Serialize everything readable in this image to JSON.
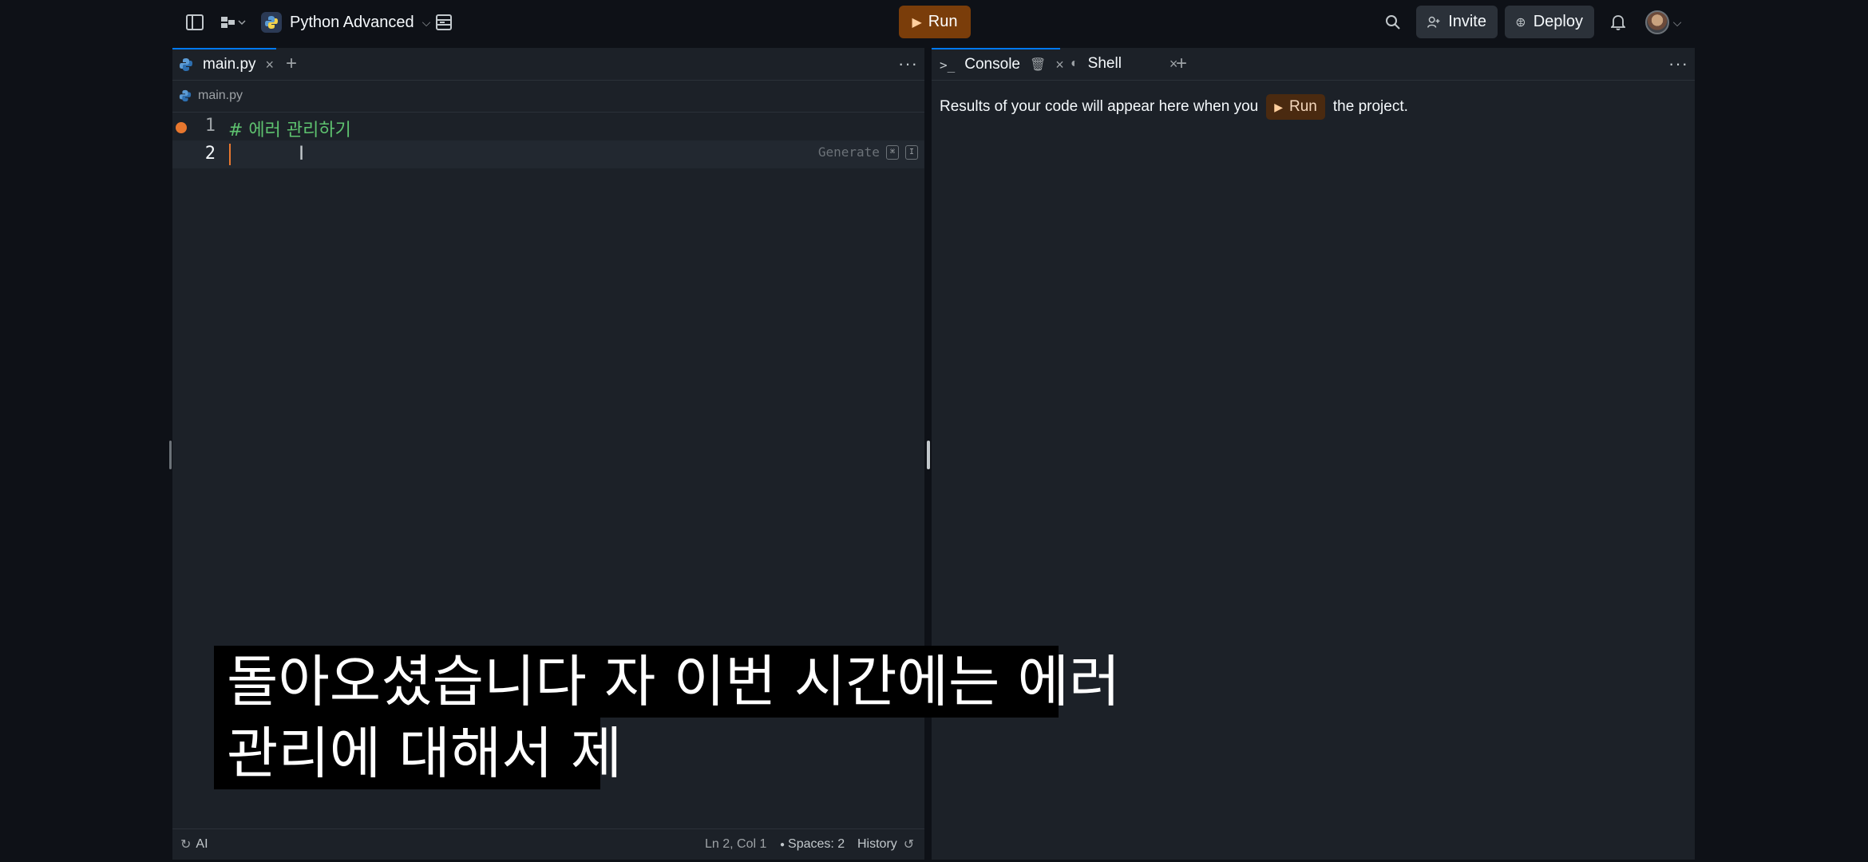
{
  "topbar": {
    "project_name": "Python Advanced",
    "run_label": "Run",
    "invite_label": "Invite",
    "deploy_label": "Deploy"
  },
  "editor": {
    "tab_label": "main.py",
    "breadcrumb": "main.py",
    "lines": [
      {
        "number": "1",
        "text": "# 에러 관리하기"
      },
      {
        "number": "2",
        "text": ""
      }
    ],
    "generate_hint": "Generate",
    "generate_kbd_1": "⌘",
    "generate_kbd_2": "I"
  },
  "statusbar": {
    "ai_label": "AI",
    "position": "Ln 2, Col 1",
    "spaces": "Spaces: 2",
    "history": "History"
  },
  "console": {
    "tab_console": "Console",
    "tab_shell": "Shell",
    "message_before": "Results of your code will appear here when you",
    "run_label": "Run",
    "message_after": "the project."
  },
  "subtitles": {
    "line1": "돌아오셨습니다 자 이번 시간에는 에러",
    "line2": "관리에 대해서 제"
  },
  "colors": {
    "accent_run": "#7a3d0a",
    "tab_active": "#0079f2",
    "comment_green": "#5ec26f",
    "breakpoint": "#e8772e"
  }
}
